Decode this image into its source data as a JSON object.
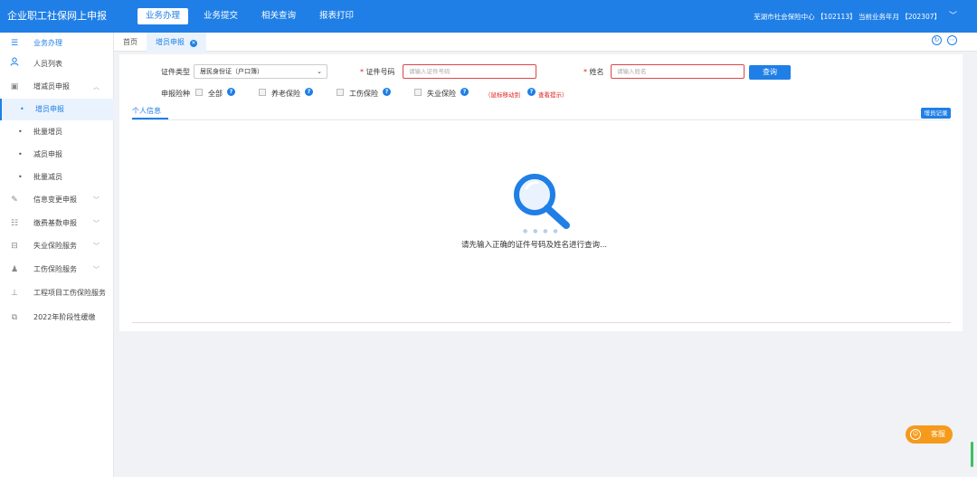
{
  "app": {
    "title": "企业职工社保网上申报",
    "nav": [
      {
        "label": "业务办理"
      },
      {
        "label": "业务提交"
      },
      {
        "label": "相关查询"
      },
      {
        "label": "报表打印"
      }
    ],
    "org_info": "芜湖市社会保险中心 【102113】 当前业务年月 【202307】"
  },
  "sidebar": {
    "items": [
      {
        "label": "业务办理",
        "icon": "menu-list-icon"
      },
      {
        "label": "人员列表",
        "icon": "person-icon"
      },
      {
        "label": "增减员申报",
        "icon": "form-icon"
      },
      {
        "label": "增员申报"
      },
      {
        "label": "批量增员"
      },
      {
        "label": "减员申报"
      },
      {
        "label": "批量减员"
      },
      {
        "label": "信息变更申报",
        "icon": "edit-doc-icon"
      },
      {
        "label": "缴费基数申报",
        "icon": "sliders-icon"
      },
      {
        "label": "失业保险服务",
        "icon": "briefcase-icon"
      },
      {
        "label": "工伤保险服务",
        "icon": "worker-icon"
      },
      {
        "label": "工程项目工伤保险服务",
        "icon": "org-tree-icon"
      },
      {
        "label": "2022年阶段性缓缴",
        "icon": "copy-icon"
      }
    ]
  },
  "tabs": {
    "home": "首页",
    "current": "增员申报"
  },
  "form": {
    "id_type_label": "证件类型",
    "id_type_value": "居民身份证（户口簿）",
    "id_number_label": "证件号码",
    "id_number_placeholder": "请输入证件号码",
    "name_label": "姓名",
    "name_placeholder": "请输入姓名",
    "required_mark": "*",
    "query_button": "查询",
    "insurance_label": "申报险种",
    "insurance_options": [
      "全部",
      "养老保险",
      "工伤保险",
      "失业保险"
    ],
    "hint_text": "（鼠标移动到",
    "hint_link": "查看提示）",
    "help_glyph": "?"
  },
  "content": {
    "subtab": "个人信息",
    "record_button": "增员记录",
    "empty_message": "请先输入正确的证件号码及姓名进行查询..."
  },
  "float": {
    "service_label": "客服"
  },
  "colors": {
    "primary": "#1f7fe6",
    "required": "#e02020",
    "service": "#f59a1a"
  }
}
